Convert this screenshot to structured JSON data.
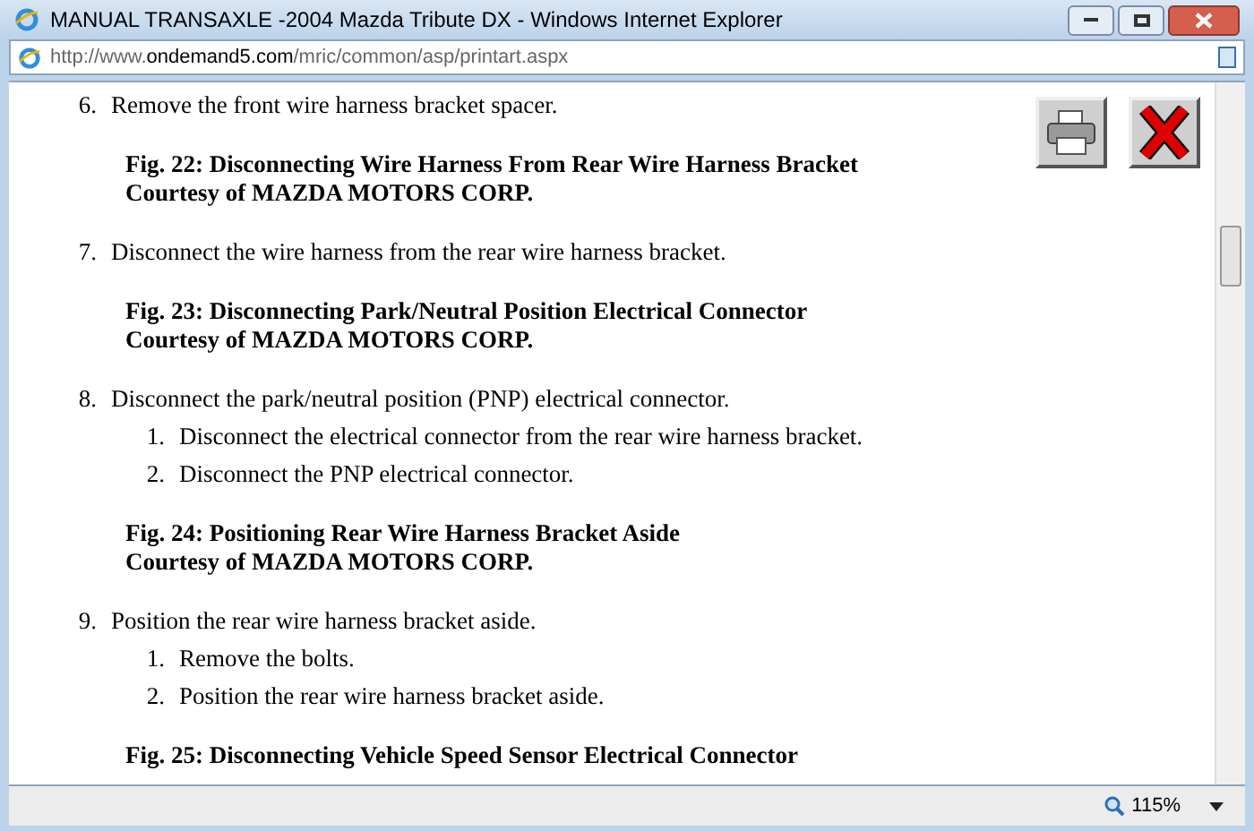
{
  "window": {
    "title": "MANUAL TRANSAXLE -2004 Mazda Tribute DX - Windows Internet Explorer"
  },
  "address_bar": {
    "url": "http://www.**ondemand5.com**/mric/common/asp/printart.aspx"
  },
  "content": [
    {
      "kind": "step",
      "number": "6.",
      "text": "Remove the front wire harness bracket spacer."
    },
    {
      "kind": "figure",
      "caption": "Fig. 22: Disconnecting Wire Harness From Rear Wire Harness Bracket",
      "credit": "Courtesy of MAZDA MOTORS CORP."
    },
    {
      "kind": "step",
      "number": "7.",
      "text": "Disconnect the wire harness from the rear wire harness bracket."
    },
    {
      "kind": "figure",
      "caption": "Fig. 23: Disconnecting Park/Neutral Position Electrical Connector",
      "credit": "Courtesy of MAZDA MOTORS CORP."
    },
    {
      "kind": "step",
      "number": "8.",
      "text": "Disconnect the park/neutral position (PNP) electrical connector.",
      "substeps": [
        {
          "number": "1.",
          "text": "Disconnect the electrical connector from the rear wire harness bracket."
        },
        {
          "number": "2.",
          "text": "Disconnect the PNP electrical connector."
        }
      ]
    },
    {
      "kind": "figure",
      "caption": "Fig. 24: Positioning Rear Wire Harness Bracket Aside",
      "credit": "Courtesy of MAZDA MOTORS CORP."
    },
    {
      "kind": "step",
      "number": "9.",
      "text": "Position the rear wire harness bracket aside.",
      "substeps": [
        {
          "number": "1.",
          "text": "Remove the bolts."
        },
        {
          "number": "2.",
          "text": "Position the rear wire harness bracket aside."
        }
      ]
    },
    {
      "kind": "figure",
      "caption": "Fig. 25: Disconnecting Vehicle Speed Sensor Electrical Connector"
    }
  ],
  "status_bar": {
    "zoom": "115%"
  }
}
